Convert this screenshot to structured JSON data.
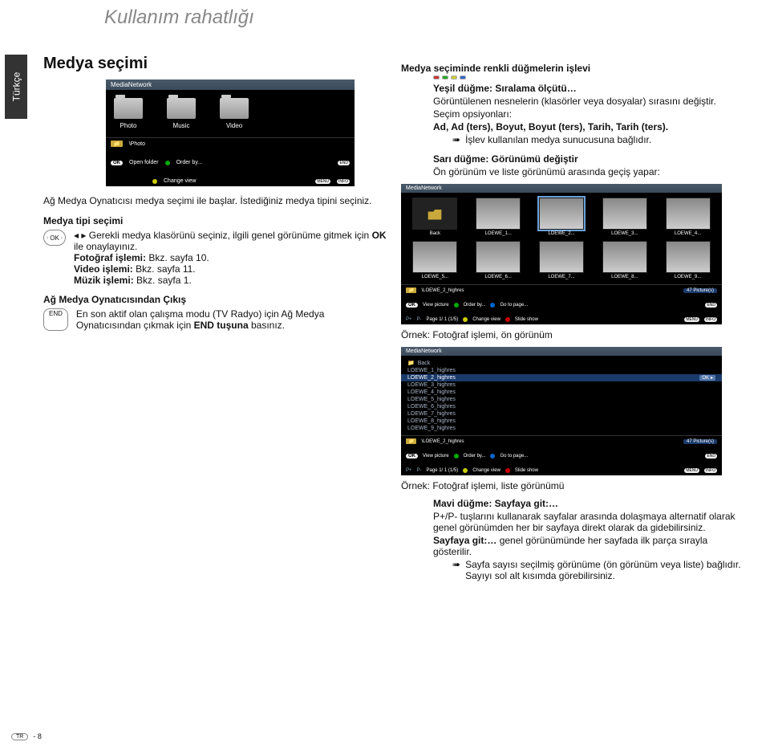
{
  "page": {
    "title": "Kullanım rahatlığı",
    "lang_tab": "Türkçe",
    "page_num": "- 8",
    "tr_label": "TR"
  },
  "left": {
    "heading": "Medya seçimi",
    "bb": {
      "title": "MediaNetwork",
      "items": [
        "Photo",
        "Music",
        "Video"
      ],
      "path": "\\Photo",
      "ok": "OK",
      "open": "Open folder",
      "order": "Order by...",
      "change": "Change view",
      "end": "END",
      "menu": "MENU",
      "info": "INFO"
    },
    "p1": "Ağ Medya Oynatıcısı medya seçimi ile başlar. İstediğiniz medya tipini seçiniz.",
    "sub1": "Medya tipi seçimi",
    "ok_label": "OK",
    "ok_text1": "Gerekli medya klasörünü seçiniz, ilgili genel görünüme gitmek için ",
    "ok_text1b": "OK",
    "ok_text1c": " ile onaylayınız.",
    "ok_line2a": "Fotoğraf işlemi:",
    "ok_line2b": " Bkz. sayfa 10.",
    "ok_line3a": "Video işlemi:",
    "ok_line3b": " Bkz. sayfa 11.",
    "ok_line4a": "Müzik işlemi:",
    "ok_line4b": " Bkz. sayfa 1.",
    "sub2": "Ağ Medya Oynatıcısından Çıkış",
    "end_label": "END",
    "end_text1": "En son aktif olan çalışma modu (TV Radyo) için Ağ Medya Oynatıcısından çıkmak için ",
    "end_text1b": "END tuşuna",
    "end_text1c": " basınız."
  },
  "right": {
    "h1": "Medya seçiminde renkli düğmelerin işlevi",
    "g1a": "Yeşil düğme: Sıralama ölçütü…",
    "g1b": "Görüntülenen nesnelerin (klasörler veya dosyalar) sırasını değiştir.",
    "g1c": "Seçim opsiyonları:",
    "g1d": "Ad, Ad (ters), Boyut, Boyut (ters), Tarih, Tarih (ters).",
    "g1e": "İşlev kullanılan medya sunucusuna bağlıdır.",
    "y1a": "Sarı düğme: Görünümü değiştir",
    "y1b": "Ön görünüm ve liste görünümü arasında geçiş yapar:",
    "grid": {
      "title": "MediaNetwork",
      "back": "Back",
      "r1": [
        "LOEWE_1...",
        "LOEWE_2...",
        "LOEWE_3...",
        "LOEWE_4..."
      ],
      "r2": [
        "LOEWE_5...",
        "LOEWE_6...",
        "LOEWE_7...",
        "LOEWE_8...",
        "LOEWE_9..."
      ],
      "path": "\\LOEWE_2_highres",
      "pics": "47 Picture(s)",
      "ok": "OK",
      "view": "View picture",
      "order": "Order by...",
      "change": "Change view",
      "goto": "Go to page...",
      "slide": "Slide show",
      "page": "Page  1/  1 (1/5)",
      "end": "END",
      "menu": "MENU",
      "info": "INFO"
    },
    "ex1": "Örnek: Fotoğraf işlemi, ön görünüm",
    "list": {
      "title": "MediaNetwork",
      "back": "Back",
      "rows": [
        "LOEWE_1_highres",
        "LOEWE_2_highres",
        "LOEWE_3_highres",
        "LOEWE_4_highres",
        "LOEWE_5_highres",
        "LOEWE_6_highres",
        "LOEWE_7_highres",
        "LOEWE_8_highres",
        "LOEWE_9_highres"
      ],
      "ok_cell": "OK",
      "path": "\\LOEWE_2_highres",
      "pics": "47 Picture(s)",
      "ok": "OK",
      "view": "View picture",
      "order": "Order by...",
      "change": "Change view",
      "goto": "Go to page...",
      "slide": "Slide show",
      "page": "Page  1/  1 (1/5)",
      "end": "END",
      "menu": "MENU",
      "info": "INFO"
    },
    "ex2": "Örnek: Fotoğraf işlemi, liste görünümü",
    "b1a": "Mavi düğme: Sayfaya git:…",
    "b1b": "P+/P- tuşlarını kullanarak sayfalar arasında dolaşmaya alternatif olarak genel görünümden her bir sayfaya direkt olarak da gidebilirsiniz.",
    "b1c": "Sayfaya git:…",
    "b1d": " genel görünümünde her sayfada ilk parça sırayla gösterilir.",
    "b1e": "Sayfa sayısı seçilmiş görünüme (ön görünüm veya liste) bağlıdır. Sayıyı sol alt kısımda görebilirsiniz."
  }
}
